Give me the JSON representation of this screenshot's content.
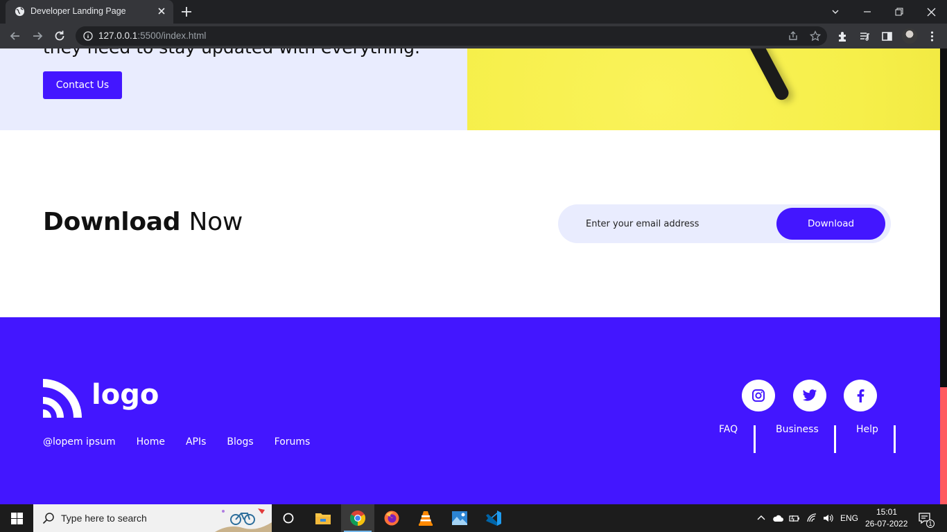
{
  "browser": {
    "tab_title": "Developer Landing Page",
    "url_host": "127.0.0.1",
    "url_rest": ":5500/index.html"
  },
  "hero": {
    "cut_text": "they need to stay updated with everything.",
    "contact_button": "Contact Us",
    "accent_color": "#4316ff",
    "image_bg_color": "#f6ef4a"
  },
  "download": {
    "title_bold": "Download",
    "title_light": "Now",
    "email_placeholder": "Enter your email address",
    "button_label": "Download"
  },
  "footer": {
    "logo_text": "logo",
    "links": [
      "@lopem ipsum",
      "Home",
      "APIs",
      "Blogs",
      "Forums"
    ],
    "social_icons": [
      "instagram-icon",
      "twitter-icon",
      "facebook-icon"
    ],
    "help_links": [
      "FAQ",
      "Business",
      "Help"
    ],
    "bg_color": "#4316ff"
  },
  "taskbar": {
    "search_placeholder": "Type here to search",
    "lang": "ENG",
    "time": "15:01",
    "date": "26-07-2022",
    "notification_count": "1"
  }
}
